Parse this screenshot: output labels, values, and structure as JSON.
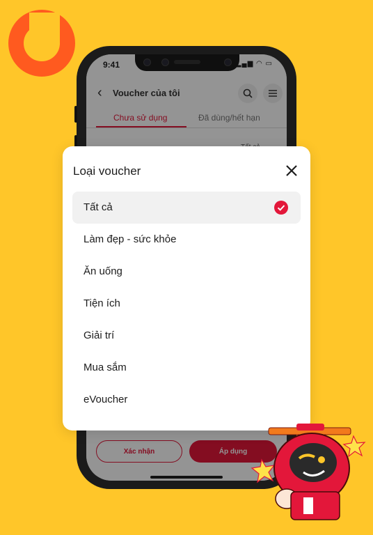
{
  "status_bar": {
    "time": "9:41",
    "icons": "▂▄▆ ◠ ▭"
  },
  "header": {
    "title": "Voucher của tôi"
  },
  "tabs": [
    {
      "label": "Chưa sử dụng",
      "active": true
    },
    {
      "label": "Đã dùng/hết hạn",
      "active": false
    }
  ],
  "background_hint": "Tất cả",
  "modal": {
    "title": "Loại voucher",
    "options": [
      {
        "label": "Tất cả",
        "selected": true
      },
      {
        "label": "Làm đẹp - sức khỏe",
        "selected": false
      },
      {
        "label": "Ăn uống",
        "selected": false
      },
      {
        "label": "Tiện ích",
        "selected": false
      },
      {
        "label": "Giải trí",
        "selected": false
      },
      {
        "label": "Mua sắm",
        "selected": false
      },
      {
        "label": "eVoucher",
        "selected": false
      }
    ]
  },
  "footer": {
    "confirm_label": "Xác nhận",
    "apply_label": "Áp dụng"
  },
  "colors": {
    "background": "#FFC629",
    "accent": "#E3173A",
    "logo": "#FF5A1F"
  },
  "icons": [
    "brand-logo",
    "back-arrow-icon",
    "search-icon",
    "menu-icon",
    "close-icon",
    "check-icon",
    "mascot-illustration"
  ]
}
